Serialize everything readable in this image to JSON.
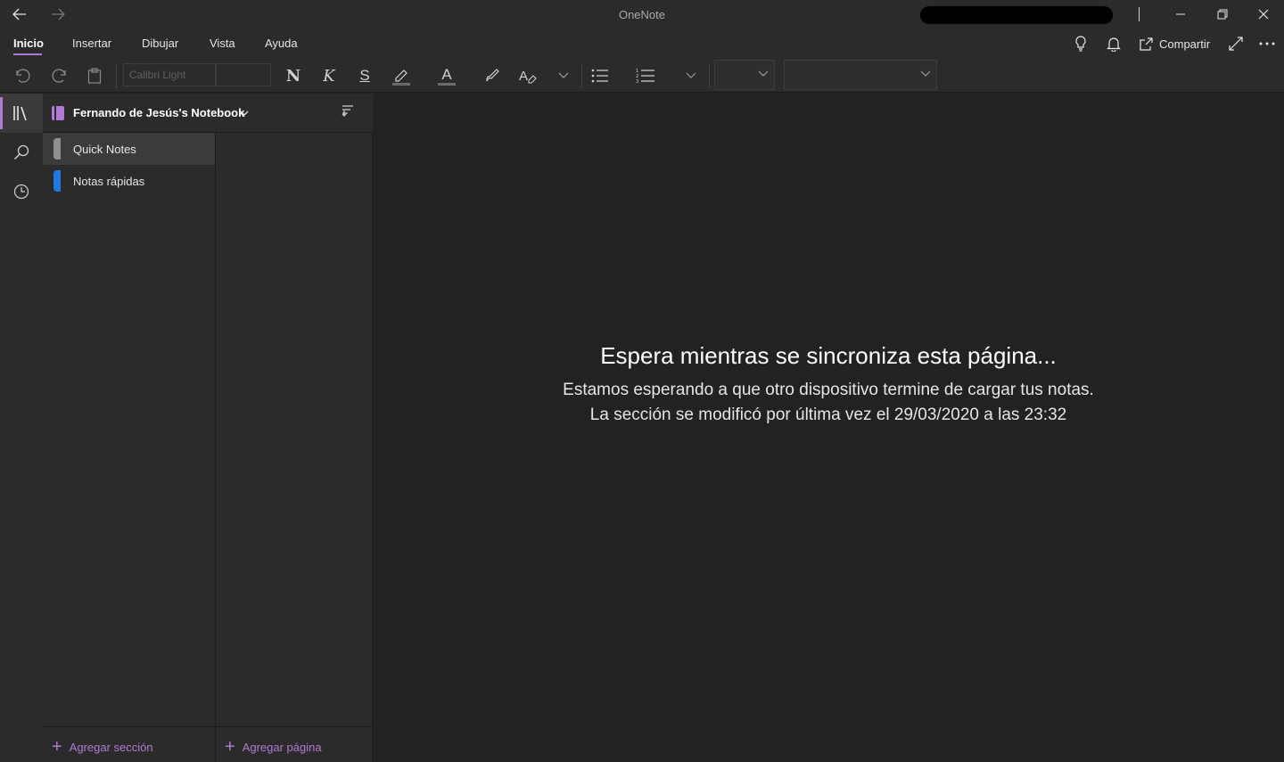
{
  "window": {
    "title": "OneNote",
    "back_icon": "arrow-left-icon",
    "forward_icon": "arrow-right-icon"
  },
  "ribbon": {
    "tabs": [
      {
        "label": "Inicio",
        "active": true
      },
      {
        "label": "Insertar",
        "active": false
      },
      {
        "label": "Dibujar",
        "active": false
      },
      {
        "label": "Vista",
        "active": false
      },
      {
        "label": "Ayuda",
        "active": false
      }
    ],
    "share_label": "Compartir"
  },
  "toolbar": {
    "font_name_placeholder": "Calibri Light",
    "font_size_value": "",
    "bold_glyph": "N",
    "italic_glyph": "K",
    "underline_glyph": "S",
    "text_color_glyph": "A",
    "style_value": "",
    "heading_value": ""
  },
  "notebook": {
    "title": "Fernando de Jesús's Notebook",
    "sections": [
      {
        "label": "Quick Notes",
        "color": "#8f8f8f",
        "selected": true
      },
      {
        "label": "Notas rápidas",
        "color": "#1f7ae0",
        "selected": false
      }
    ],
    "add_section_label": "Agregar sección",
    "add_page_label": "Agregar página"
  },
  "main": {
    "sync_title": "Espera mientras se sincroniza esta página...",
    "sync_line1": "Estamos esperando a que otro dispositivo termine de cargar tus notas.",
    "sync_line2": "La sección se modificó por última vez el 29/03/2020 a las 23:32"
  },
  "colors": {
    "accent": "#b07ad6",
    "background": "#222222",
    "panel": "#2b2b2b"
  }
}
